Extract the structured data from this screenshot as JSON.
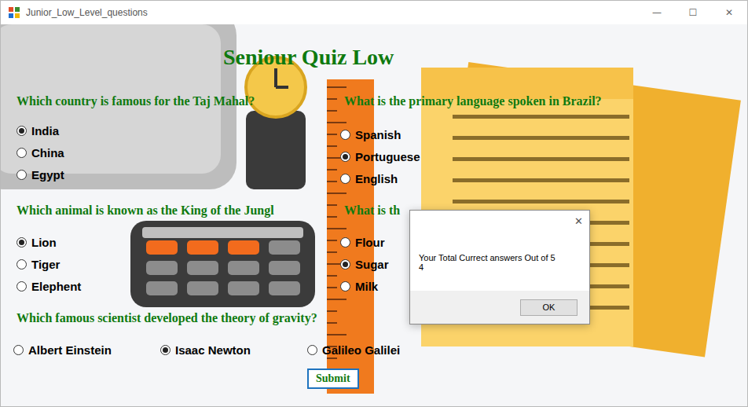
{
  "window": {
    "title": "Junior_Low_Level_questions",
    "controls": [
      "—",
      "☐",
      "✕"
    ]
  },
  "heading": "Seniour Quiz Low",
  "questions": [
    {
      "text": "Which country is famous for the Taj Mahal?",
      "kind": "column",
      "options": [
        {
          "label": "India",
          "selected": true
        },
        {
          "label": "China",
          "selected": false
        },
        {
          "label": "Egypt",
          "selected": false
        }
      ]
    },
    {
      "text": "What is the primary language spoken in Brazil?",
      "kind": "column",
      "options": [
        {
          "label": "Spanish",
          "selected": false
        },
        {
          "label": "Portuguese",
          "selected": true
        },
        {
          "label": "English",
          "selected": false
        }
      ]
    },
    {
      "text": "Which animal is known as the King of the Jungl",
      "kind": "column",
      "options": [
        {
          "label": "Lion",
          "selected": true
        },
        {
          "label": "Tiger",
          "selected": false
        },
        {
          "label": "Elephent",
          "selected": false
        }
      ]
    },
    {
      "text": "What is th",
      "kind": "column",
      "options": [
        {
          "label": "Flour",
          "selected": false
        },
        {
          "label": "Sugar",
          "selected": true
        },
        {
          "label": "Milk",
          "selected": false
        }
      ]
    },
    {
      "text": "Which famous scientist developed the theory of gravity?",
      "kind": "row",
      "options": [
        {
          "label": "Albert Einstein",
          "selected": false
        },
        {
          "label": "Isaac Newton",
          "selected": true
        },
        {
          "label": "Galileo Galilei",
          "selected": false
        }
      ]
    }
  ],
  "submit": "Submit",
  "dialog": {
    "close": "✕",
    "message": "Your Total Currect answers Out of 5",
    "score": "4",
    "buttons": [
      "OK"
    ]
  }
}
